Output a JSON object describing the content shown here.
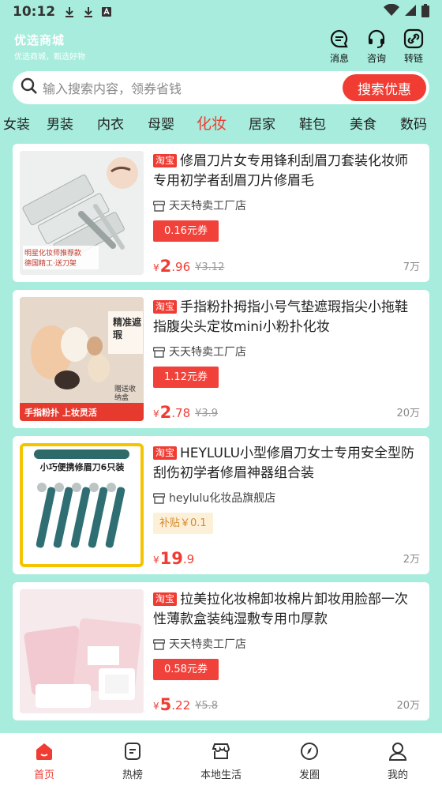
{
  "status_bar": {
    "time": "10:12"
  },
  "header": {
    "logo_title": "优选商城",
    "logo_subtitle": "优选商城，甄选好物",
    "buttons": [
      {
        "label": "消息",
        "icon": "message-icon"
      },
      {
        "label": "咨询",
        "icon": "headset-icon"
      },
      {
        "label": "转链",
        "icon": "link-icon"
      }
    ]
  },
  "search": {
    "placeholder": "输入搜索内容，领券省钱",
    "button_label": "搜索优惠"
  },
  "categories": [
    "女装",
    "男装",
    "内衣",
    "母婴",
    "化妆",
    "居家",
    "鞋包",
    "美食",
    "数码"
  ],
  "active_category": "化妆",
  "products": [
    {
      "platform": "淘宝",
      "title": "修眉刀片女专用锋利刮眉刀套装化妆师专用初学者刮眉刀片修眉毛",
      "shop": "天天特卖工厂店",
      "coupon": "0.16元券",
      "price_int": "2",
      "price_dec": ".96",
      "orig_price": "¥3.12",
      "sales": "7万",
      "thumb_text_1": "明星化妆师推荐款",
      "thumb_text_2": "德国精工·送刀架"
    },
    {
      "platform": "淘宝",
      "title": "手指粉扑拇指小号气垫遮瑕指尖小拖鞋指腹尖头定妆mini小粉扑化妆",
      "shop": "天天特卖工厂店",
      "coupon": "1.12元券",
      "price_int": "2",
      "price_dec": ".78",
      "orig_price": "¥3.9",
      "sales": "20万",
      "thumb_text_1": "精准遮瑕",
      "thumb_text_2": "赠送收纳盒",
      "thumb_text_3": "手指粉扑 上妆灵活"
    },
    {
      "platform": "淘宝",
      "title": "HEYLULU小型修眉刀女士专用安全型防刮伤初学者修眉神器组合装",
      "shop": "heylulu化妆品旗舰店",
      "subsidy": "补贴￥0.1",
      "price_int": "19",
      "price_dec": ".9",
      "orig_price": "",
      "sales": "2万",
      "thumb_text_1": "小巧便携修眉刀6只装"
    },
    {
      "platform": "淘宝",
      "title": "拉美拉化妆棉卸妆棉片卸妆用脸部一次性薄款盒装纯湿敷专用巾厚款",
      "shop": "天天特卖工厂店",
      "coupon": "0.58元券",
      "price_int": "5",
      "price_dec": ".22",
      "orig_price": "¥5.8",
      "sales": "20万"
    }
  ],
  "tabbar": [
    {
      "label": "首页",
      "icon": "home-icon",
      "active": true
    },
    {
      "label": "热榜",
      "icon": "list-icon",
      "active": false
    },
    {
      "label": "本地生活",
      "icon": "store-icon",
      "active": false
    },
    {
      "label": "发圈",
      "icon": "compass-icon",
      "active": false
    },
    {
      "label": "我的",
      "icon": "user-icon",
      "active": false
    }
  ],
  "colors": {
    "background": "#a7ecdc",
    "accent": "#f03c33",
    "card": "#ffffff"
  }
}
